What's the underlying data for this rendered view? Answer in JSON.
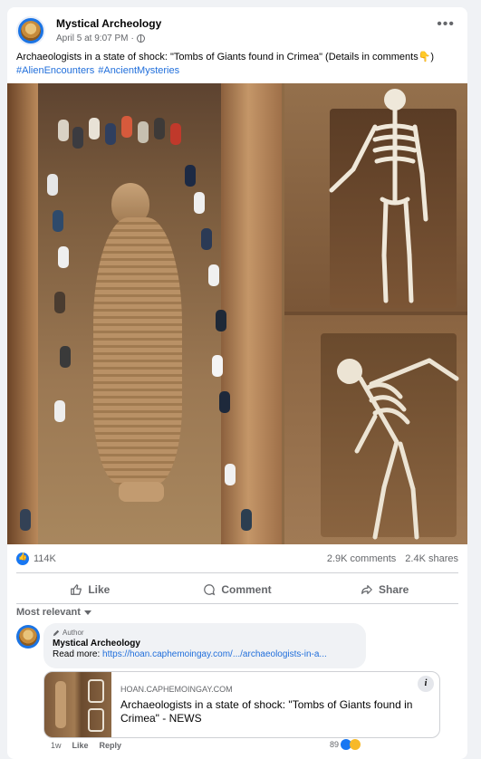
{
  "post": {
    "page_name": "Mystical Archeology",
    "timestamp": "April 5 at 9:07 PM",
    "separator": "·",
    "caption": "Archaeologists in a state of shock: \"Tombs of Giants found in Crimea\" (Details in comments👇)",
    "hashtags": [
      "#AlienEncounters",
      "#AncientMysteries"
    ],
    "more_label": "•••"
  },
  "stats": {
    "likes": "114K",
    "comments": "2.9K comments",
    "shares": "2.4K shares"
  },
  "actions": {
    "like": "Like",
    "comment": "Comment",
    "share": "Share"
  },
  "comments_filter": "Most relevant",
  "comment": {
    "author_tag": "Author",
    "name": "Mystical Archeology",
    "read_more": "Read more:",
    "link": "https://hoan.caphemoingay.com/.../archaeologists-in-a...",
    "time": "1w",
    "like": "Like",
    "reply": "Reply",
    "reactions": "89"
  },
  "link_card": {
    "domain": "HOAN.CAPHEMOINGAY.COM",
    "title": "Archaeologists in a state of shock: \"Tombs of Giants found in Crimea\" - NEWS",
    "info_icon": "i"
  },
  "colors": {
    "brand_blue": "#1877f2",
    "link_blue": "#216fdb",
    "muted": "#65676b"
  }
}
